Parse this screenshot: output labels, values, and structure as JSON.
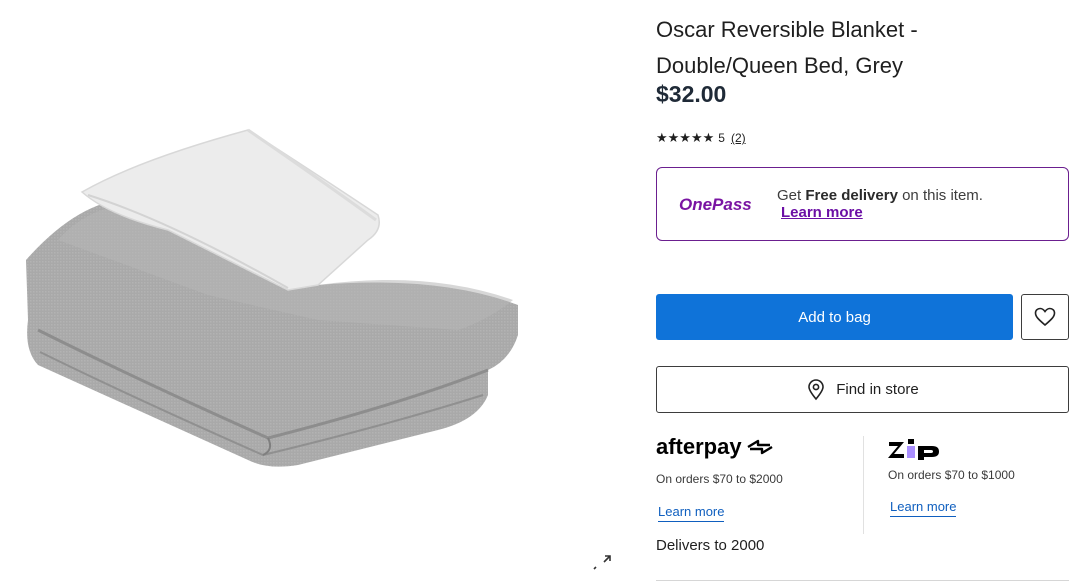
{
  "product": {
    "title_line1": "Oscar Reversible Blanket -",
    "title_line2": "Double/Queen Bed, Grey",
    "price": "$32.00",
    "rating_stars": "★★★★★",
    "rating_value": "5",
    "review_count": "(2)",
    "image_icon": "folded-blanket-image"
  },
  "onepass": {
    "logo": "OnePass",
    "text_prefix": "Get ",
    "text_bold": "Free delivery",
    "text_suffix": " on this item.",
    "learn_more": "Learn more",
    "brand_color": "#6b0fa5"
  },
  "actions": {
    "add_to_bag": "Add to bag",
    "wishlist_icon": "heart-icon",
    "find_in_store": "Find in store",
    "find_icon": "location-pin-icon",
    "accent_color": "#0f73d9"
  },
  "payments": {
    "afterpay": {
      "logo": "afterpay",
      "terms": "On orders $70 to $2000",
      "learn_more": "Learn more"
    },
    "zip": {
      "logo": "zip",
      "terms": "On orders $70 to $1000",
      "learn_more": "Learn more"
    }
  },
  "delivery": {
    "text": "Delivers to 2000"
  }
}
